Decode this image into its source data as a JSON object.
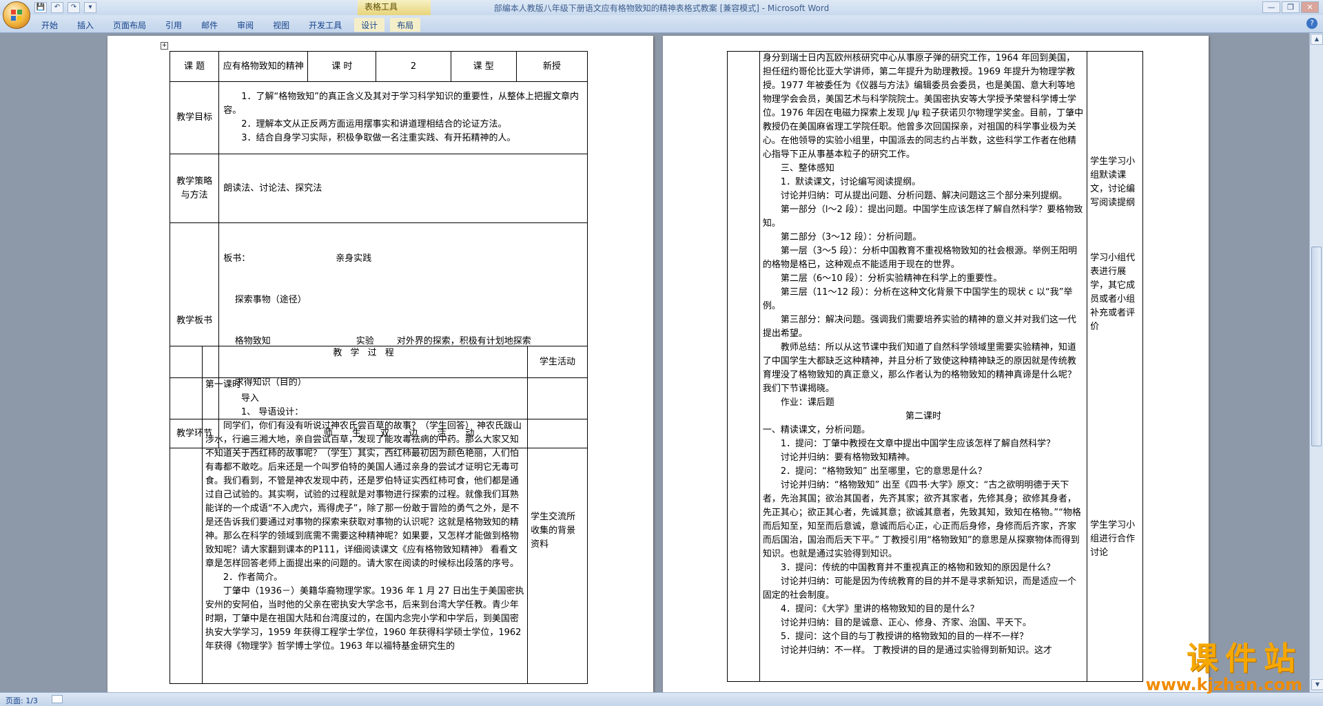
{
  "window": {
    "title": "部编本人教版八年级下册语文应有格物致知的精神表格式教案 [兼容模式] - Microsoft Word",
    "context_tab_title": "表格工具"
  },
  "qat": {
    "save": "💾",
    "undo": "↶",
    "redo": "↷",
    "more": "▾"
  },
  "window_controls": {
    "minimize": "—",
    "restore": "❐",
    "close": "✕"
  },
  "ribbon": {
    "tabs": [
      "开始",
      "插入",
      "页面布局",
      "引用",
      "邮件",
      "审阅",
      "视图",
      "开发工具",
      "设计",
      "布局"
    ],
    "help": "?"
  },
  "left_page": {
    "header_row": {
      "topic_label": "课  题",
      "topic_value": "应有格物致知的精神",
      "hours_label": "课  时",
      "hours_value": "2",
      "type_label": "课  型",
      "type_value": "新授"
    },
    "goals_label": "教学目标",
    "goals": [
      "1．了解“格物致知”的真正含义及其对于学习科学知识的重要性，从整体上把握文章内容。",
      "2．理解本文从正反两方面运用摆事实和讲道理相结合的论证方法。",
      "3．结合自身学习实际，积极争取做一名注重实践、有开拓精神的人。"
    ],
    "strategy_label": "教学策略与方法",
    "strategy_value": "朗读法、讨论法、探究法",
    "board_label": "教学板书",
    "board_lines": [
      "板书：                              亲身实践",
      "    探索事物（途径）",
      "    格物致知                              实验        对外界的探索，积极有计划地探索",
      "    求得知识（目的）"
    ],
    "stage_label": "教学环节",
    "stage_value": "师 生 双 边 活 动",
    "process_header": "教 学 过 程",
    "activity_header": "学生活动",
    "process_paragraphs": [
      {
        "style": "noind",
        "text": "第一课时"
      },
      {
        "style": "normal",
        "text": "导入"
      },
      {
        "style": "normal",
        "text": "1、 导语设计："
      },
      {
        "style": "normal",
        "text": "同学们，你们有没有听说过神农氏尝百草的故事？（学生回答） 神农氏跋山涉水，行遍三湘大地，亲自尝试百草，发现了能攻毒祛病的中药。那么大家又知不知道关于西红柿的故事呢？（学生）其实，西红柿最初因为颜色艳丽，人们怕有毒都不敢吃。后来还是一个叫罗伯特的美国人通过亲身的尝试才证明它无毒可食。我们看到，不管是神农发现中药，还是罗伯特证实西红柿可食，他们都是通过自己试验的。其实啊，试验的过程就是对事物进行探索的过程。就像我们耳熟能详的一个成语“不入虎穴，焉得虎子”，除了那一份敢于冒险的勇气之外，是不是还告诉我们要通过对事物的探索来获取对事物的认识呢？这就是格物致知的精神。那么在科学的领域到底需不需要这种精神呢？如果要，又怎样才能做到格物致知呢？请大家翻到课本的P111，详细阅读课文《应有格物致知精神》 看看文章是怎样回答老师上面提出来的问题的。请大家在阅读的时候标出段落的序号。"
      },
      {
        "style": "normal",
        "text": "2．作者简介。"
      },
      {
        "style": "normal",
        "text": "丁肇中（1936－）美籍华裔物理学家。1936 年 1 月 27 日出生于美国密执安州的安阿伯，当时他的父亲在密执安大学念书，后来到台湾大学任教。青少年时期，丁肇中是在祖国大陆和台湾度过的，在国内念完小学和中学后，到美国密执安大学学习，1959 年获得工程学士学位，1960 年获得科学硕士学位，1962 年获得《物理学》哲学博士学位。1963 年以福特基金研究生的"
      }
    ],
    "activity_note": "学生交流所收集的背景资料"
  },
  "right_page": {
    "paragraphs": [
      {
        "style": "noind",
        "text": "身分到瑞士日内瓦欧州核研究中心从事原子弹的研究工作，1964 年回到美国，担任纽约哥伦比亚大学讲师，第二年提升为助理教授。1969 年提升为物理学教授。1977 年被委任为《仪器与方法》编辑委员会委员，也是美国、意大利等地物理学会会员，美国艺术与科学院院士。美国密执安等大学授予荣誉科学博士学位。1976 年因在电磁力探索上发现 J/ψ 粒子获诺贝尔物理学奖金。目前，丁肇中教授仍在美国麻省理工学院任职。他曾多次回国探亲，对祖国的科学事业极为关心。在他领导的实验小组里，中国派去的同志约占半数，这些科学工作者在他精心指导下正从事基本粒子的研究工作。"
      },
      {
        "style": "normal",
        "text": "三、整体感知"
      },
      {
        "style": "normal",
        "text": "1．默读课文，讨论编写阅读提纲。"
      },
      {
        "style": "normal",
        "text": "讨论并归纳：可从提出问题、分析问题、解决问题这三个部分来列提纲。"
      },
      {
        "style": "normal",
        "text": "第一部分（l～2 段）：提出问题。中国学生应该怎样了解自然科学？要格物致知。"
      },
      {
        "style": "normal",
        "text": "第二部分（3～12 段）：分析问题。"
      },
      {
        "style": "normal",
        "text": "第一层（3～5 段）：分析中国教育不重视格物致知的社会根源。举例王阳明的格物是格已，这种观点不能适用于现在的世界。"
      },
      {
        "style": "normal",
        "text": "第二层（6～10 段）：分析实验精神在科学上的重要性。"
      },
      {
        "style": "normal",
        "text": "第三层（11～12 段）：分析在这种文化背景下中国学生的现状 c 以“我”举例。"
      },
      {
        "style": "normal",
        "text": "第三部分：解决问题。强调我们需要培养实验的精神的意义并对我们这一代提出希望。"
      },
      {
        "style": "normal",
        "text": "教师总结：所以从这节课中我们知道了自然科学领域里需要实验精神，知道了中国学生大都缺乏这种精神，并且分析了致使这种精神缺乏的原因就是传统教育埋没了格物致知的真正意义，那么作者认为的格物致知的精神真谛是什么呢？我们下节课揭晓。"
      },
      {
        "style": "normal",
        "text": "作业：课后题"
      },
      {
        "style": "center",
        "text": "第二课时"
      },
      {
        "style": "noind",
        "text": "一、精读课文，分析问题。"
      },
      {
        "style": "normal",
        "text": "1．提问：丁肇中教授在文章中提出中国学生应该怎样了解自然科学？"
      },
      {
        "style": "normal",
        "text": "讨论并归纳：要有格物致知精神。"
      },
      {
        "style": "normal",
        "text": "2．提问：“格物致知” 出至哪里，它的意思是什么？"
      },
      {
        "style": "normal",
        "text": "讨论并归纳：“格物致知” 出至《四书·大学》原文：“古之欲明明德于天下者，先治其国；欲治其国者，先齐其家；欲齐其家者，先修其身；欲修其身者，先正其心；欲正其心者，先诚其意；欲诚其意者，先致其知，致知在格物。”“物格而后知至，知至而后意诚，意诚而后心正，心正而后身修，身修而后齐家，齐家而后国治，国治而后天下平。” 丁教授引用“格物致知”的意思是从探察物体而得到知识。也就是通过实验得到知识。"
      },
      {
        "style": "normal",
        "text": "3．提问：传统的中国教育并不重视真正的格物和致知的原因是什么？"
      },
      {
        "style": "normal",
        "text": "讨论并归纳：可能是因为传统教育的目的并不是寻求新知识，而是适应一个固定的社会制度。"
      },
      {
        "style": "normal",
        "text": "4．提问：《大学》里讲的格物致知的目的是什么？"
      },
      {
        "style": "normal",
        "text": "讨论并归纳：目的是诚意、正心、修身、齐家、治国、平天下。"
      },
      {
        "style": "normal",
        "text": "5．提问：这个目的与丁教授讲的格物致知的目的一样不一样？"
      },
      {
        "style": "normal",
        "text": "讨论并归纳：不一样。 丁教授讲的目的是通过实验得到新知识。这才"
      }
    ],
    "side_note_1": "学生学习小组默读课文，讨论编写阅读提纲",
    "side_note_2": "学习小组代表进行展学，其它成员或者小组补充或者评价",
    "side_note_3": "学生学习小组进行合作讨论"
  },
  "status": {
    "page": "页面: 1/3"
  },
  "scrollbar": {
    "up": "▲",
    "down": "▼"
  },
  "watermark": {
    "title": "课件站",
    "url": "www.kjzhan.com"
  }
}
